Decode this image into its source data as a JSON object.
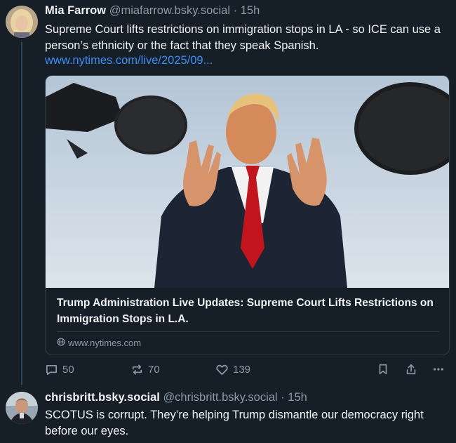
{
  "post1": {
    "author_name": "Mia Farrow",
    "author_handle": "@miafarrow.bsky.social",
    "separator": "·",
    "time": "15h",
    "text": "Supreme Court lifts restrictions on immigration stops in LA - so ICE can use a person’s ethnicity or the fact that they speak Spanish.",
    "link": "www.nytimes.com/live/2025/09...",
    "card": {
      "title": "Trump Administration Live Updates: Supreme Court Lifts Restrictions on Immigration Stops in L.A.",
      "domain": "www.nytimes.com"
    },
    "actions": {
      "reply_count": "50",
      "repost_count": "70",
      "like_count": "139"
    }
  },
  "post2": {
    "author_name": "chrisbritt.bsky.social",
    "author_handle": "@chrisbritt.bsky.social",
    "separator": "·",
    "time": "15h",
    "text": "SCOTUS is corrupt. They’re helping Trump dismantle our democracy right before our eyes."
  },
  "colors": {
    "background": "#161e27",
    "text": "#f1f3f5",
    "muted": "#8d9aa8",
    "link": "#3b8ff5",
    "border": "#2e3c4a"
  }
}
